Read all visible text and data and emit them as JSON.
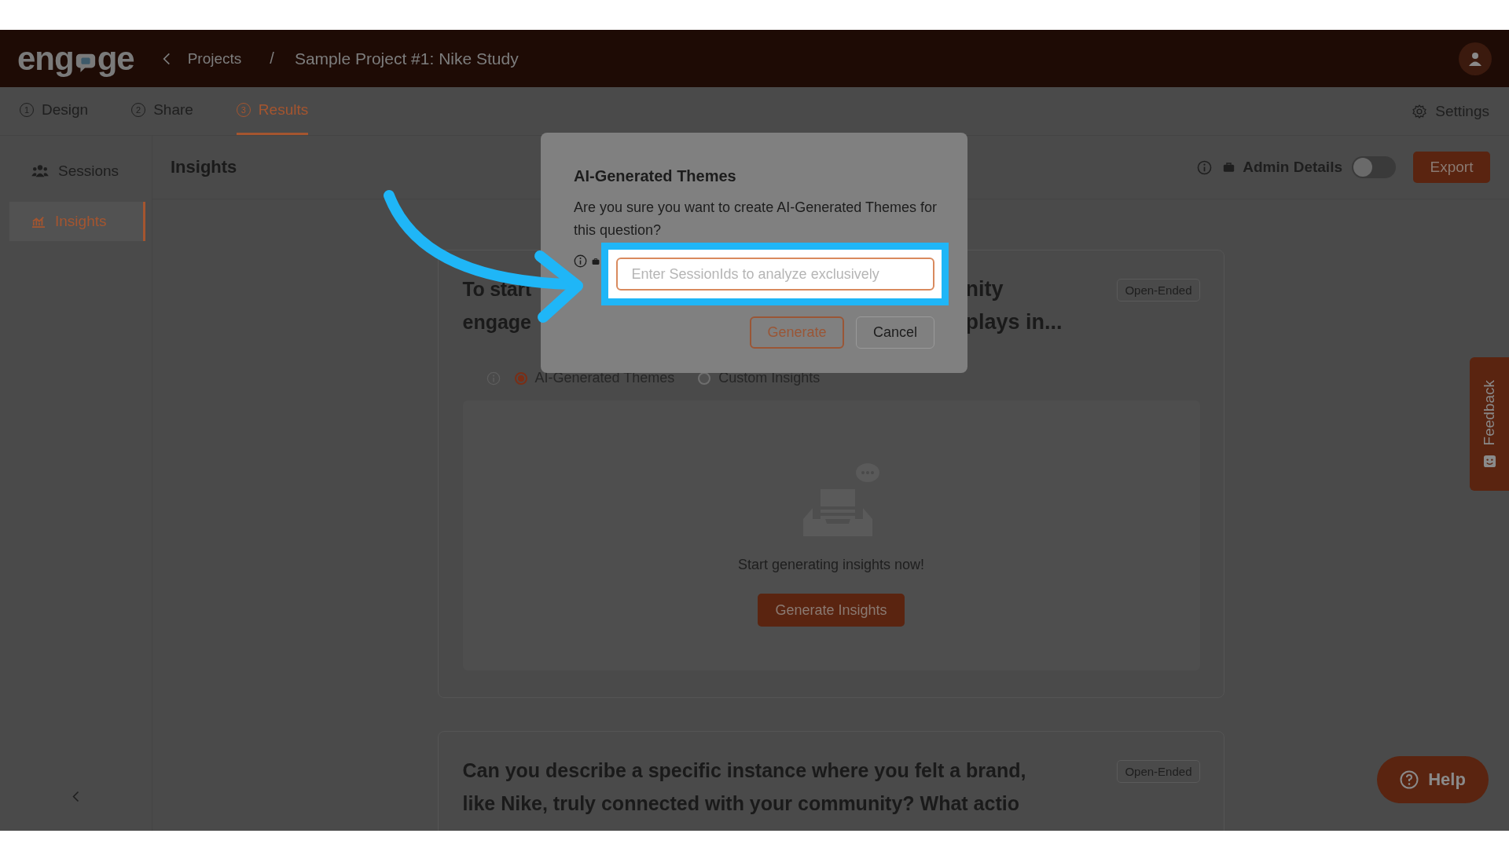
{
  "header": {
    "logo_parts": [
      "eng",
      "ge"
    ],
    "breadcrumb": [
      "Projects",
      "Sample Project #1: Nike Study"
    ],
    "separator": "/"
  },
  "tabs": [
    {
      "number": "1",
      "label": "Design",
      "selected": false
    },
    {
      "number": "2",
      "label": "Share",
      "selected": false
    },
    {
      "number": "3",
      "label": "Results",
      "selected": true
    }
  ],
  "settings": "Settings",
  "sidebar": {
    "items": [
      {
        "label": "Sessions",
        "selected": false
      },
      {
        "label": "Insights",
        "selected": true
      }
    ]
  },
  "toolbar": {
    "title": "Insights",
    "admin_label": "Admin Details",
    "admin_on": false,
    "export": "Export"
  },
  "questions": [
    {
      "lines": [
        {
          "left": "To start",
          "right": "nity"
        },
        {
          "left": "engage",
          "right": "plays in..."
        }
      ],
      "badge": "Open-Ended",
      "options": [
        {
          "label": "AI-Generated Themes",
          "selected": true
        },
        {
          "label": "Custom Insights",
          "selected": false
        }
      ],
      "empty_text": "Start generating insights now!",
      "action": "Generate Insights"
    },
    {
      "lines": [
        {
          "left": "Can you describe a specific instance where you felt a brand,"
        },
        {
          "left": "like Nike, truly connected with your community? What actio"
        }
      ],
      "badge": "Open-Ended"
    }
  ],
  "modal": {
    "title": "AI-Generated Themes",
    "message": "Are you sure you want to create AI-Generated Themes for this question?",
    "placeholder": "Enter SessionIds to analyze exclusively",
    "buttons": [
      "Generate",
      "Cancel"
    ]
  },
  "feedback": "Feedback",
  "help": "Help"
}
